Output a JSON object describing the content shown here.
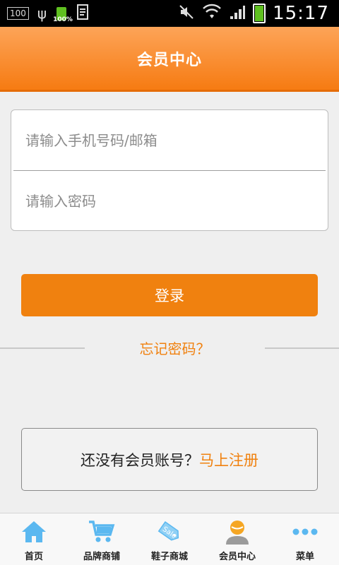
{
  "status_bar": {
    "box_label": "100",
    "battery_small_label": "100%",
    "time": "15:17"
  },
  "header": {
    "title": "会员中心"
  },
  "login_form": {
    "phone_placeholder": "请输入手机号码/邮箱",
    "password_placeholder": "请输入密码",
    "login_label": "登录",
    "forgot_label": "忘记密码？"
  },
  "register": {
    "prompt": "还没有会员账号？",
    "link_label": "马上注册"
  },
  "bottom_nav": {
    "items": [
      {
        "label": "首页",
        "icon": "home-icon"
      },
      {
        "label": "品牌商铺",
        "icon": "cart-icon"
      },
      {
        "label": "鞋子商城",
        "icon": "sale-tag-icon"
      },
      {
        "label": "会员中心",
        "icon": "member-icon"
      },
      {
        "label": "菜单",
        "icon": "more-dots-icon"
      }
    ]
  },
  "colors": {
    "accent": "#f0810f",
    "header_top": "#fda458",
    "header_bottom": "#f67b12",
    "nav_icon": "#5bb8f0"
  }
}
